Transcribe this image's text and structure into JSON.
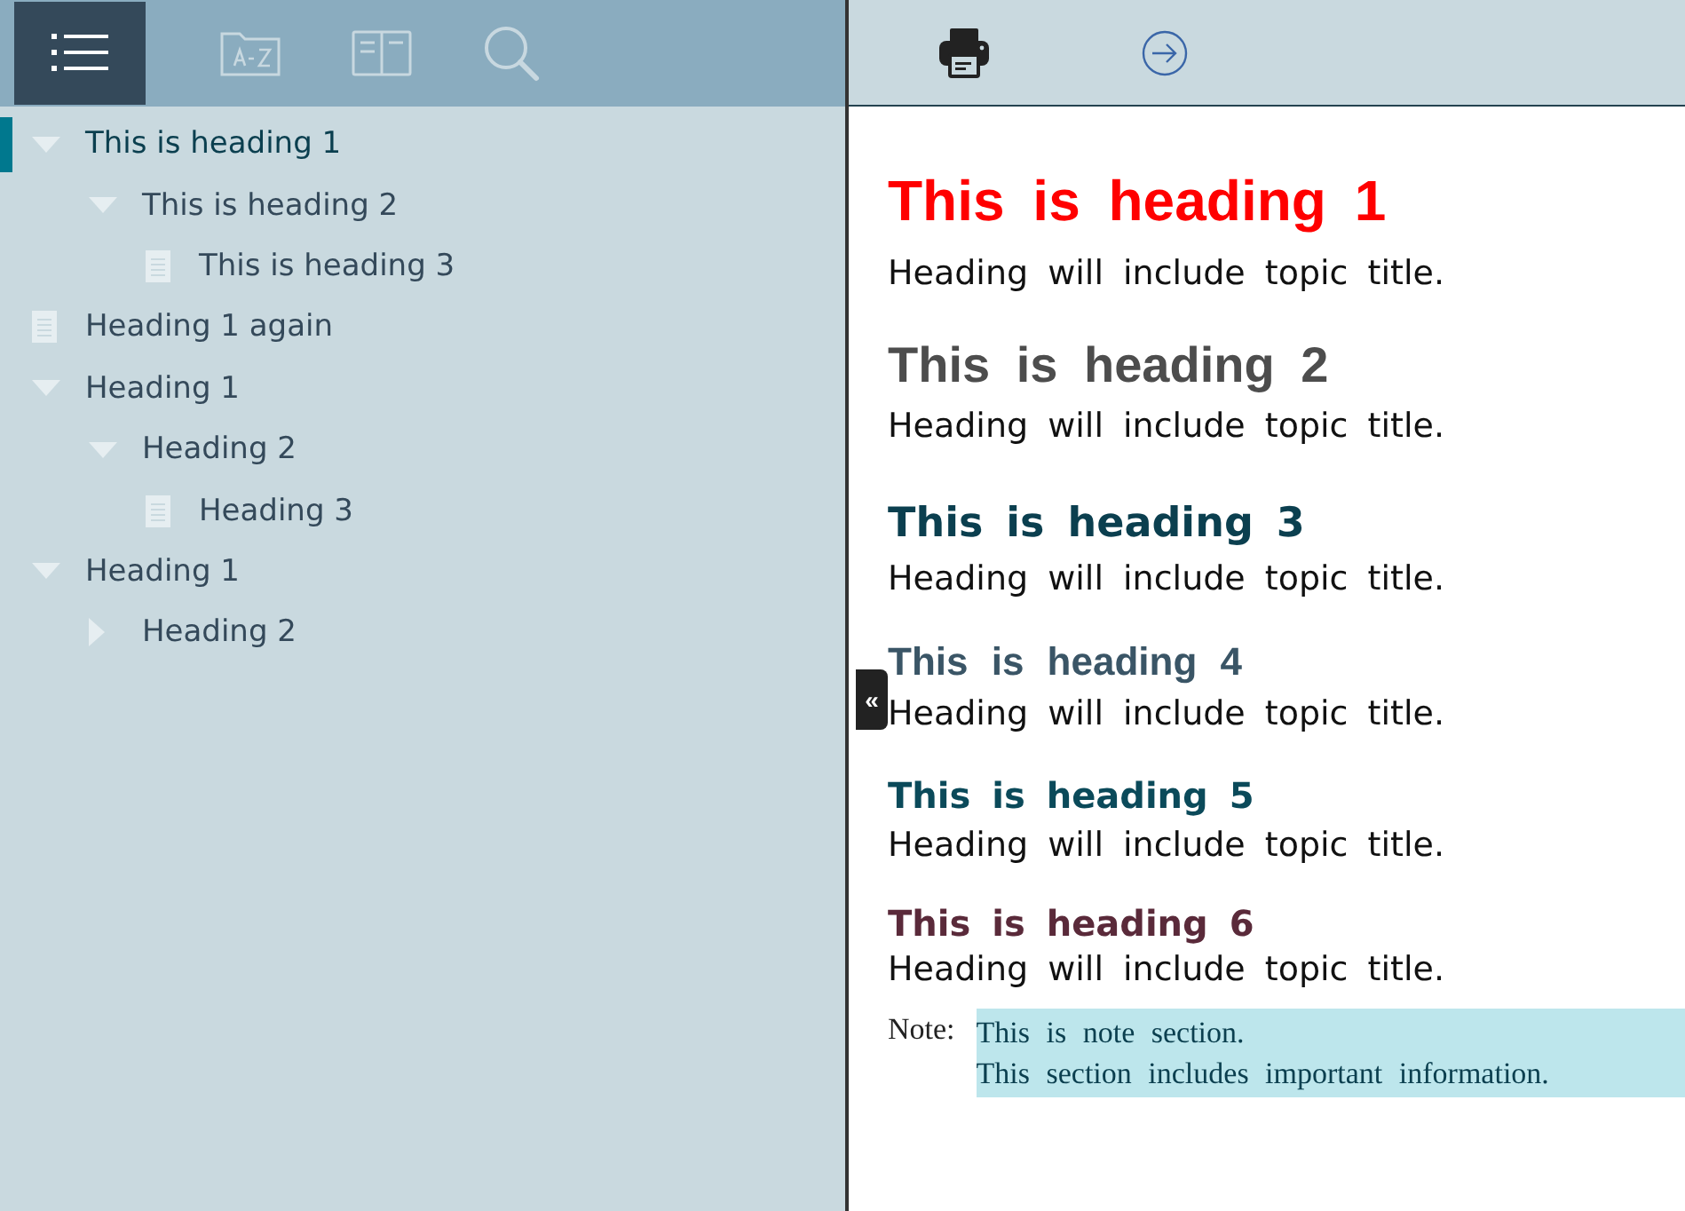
{
  "nav_tabs": [
    {
      "kind": "contents",
      "selected": true
    },
    {
      "kind": "index",
      "selected": false
    },
    {
      "kind": "glossary",
      "selected": false
    },
    {
      "kind": "search",
      "selected": false
    }
  ],
  "tree": [
    {
      "label": "This is heading 1",
      "kind": "folder",
      "expanded": true,
      "selected": true,
      "children": [
        {
          "label": "This is heading 2",
          "kind": "folder",
          "expanded": true,
          "selected": false,
          "children": [
            {
              "label": "This is heading 3",
              "kind": "page",
              "selected": false
            }
          ]
        }
      ]
    },
    {
      "label": "Heading 1 again",
      "kind": "page",
      "selected": false
    },
    {
      "label": "Heading 1",
      "kind": "folder",
      "expanded": true,
      "selected": false,
      "children": [
        {
          "label": "Heading 2",
          "kind": "folder",
          "expanded": true,
          "selected": false,
          "children": [
            {
              "label": "Heading 3",
              "kind": "page",
              "selected": false
            }
          ]
        }
      ]
    },
    {
      "label": "Heading 1",
      "kind": "folder",
      "expanded": true,
      "selected": false,
      "children": [
        {
          "label": "Heading 2",
          "kind": "folder",
          "expanded": false,
          "selected": false
        }
      ]
    }
  ],
  "toolbar": [
    {
      "kind": "print"
    },
    {
      "kind": "next"
    }
  ],
  "collapse_button": {
    "label": "«"
  },
  "content": [
    {
      "kind": "h1",
      "text": "This is heading 1"
    },
    {
      "kind": "p",
      "text": "Heading will include topic title."
    },
    {
      "kind": "h2",
      "text": "This is heading 2"
    },
    {
      "kind": "p",
      "text": "Heading will include topic title."
    },
    {
      "kind": "h3",
      "text": "This is heading 3"
    },
    {
      "kind": "p",
      "text": "Heading will include topic title."
    },
    {
      "kind": "h4",
      "text": "This is heading 4"
    },
    {
      "kind": "p",
      "text": "Heading will include topic title."
    },
    {
      "kind": "h5",
      "text": "This is heading 5"
    },
    {
      "kind": "p",
      "text": "Heading will include topic title."
    },
    {
      "kind": "h6",
      "text": "This is heading 6"
    },
    {
      "kind": "p",
      "text": "Heading will include topic title."
    },
    {
      "kind": "note",
      "label": "Note:",
      "lines": [
        "This is note section.",
        "This section includes important information."
      ]
    }
  ]
}
